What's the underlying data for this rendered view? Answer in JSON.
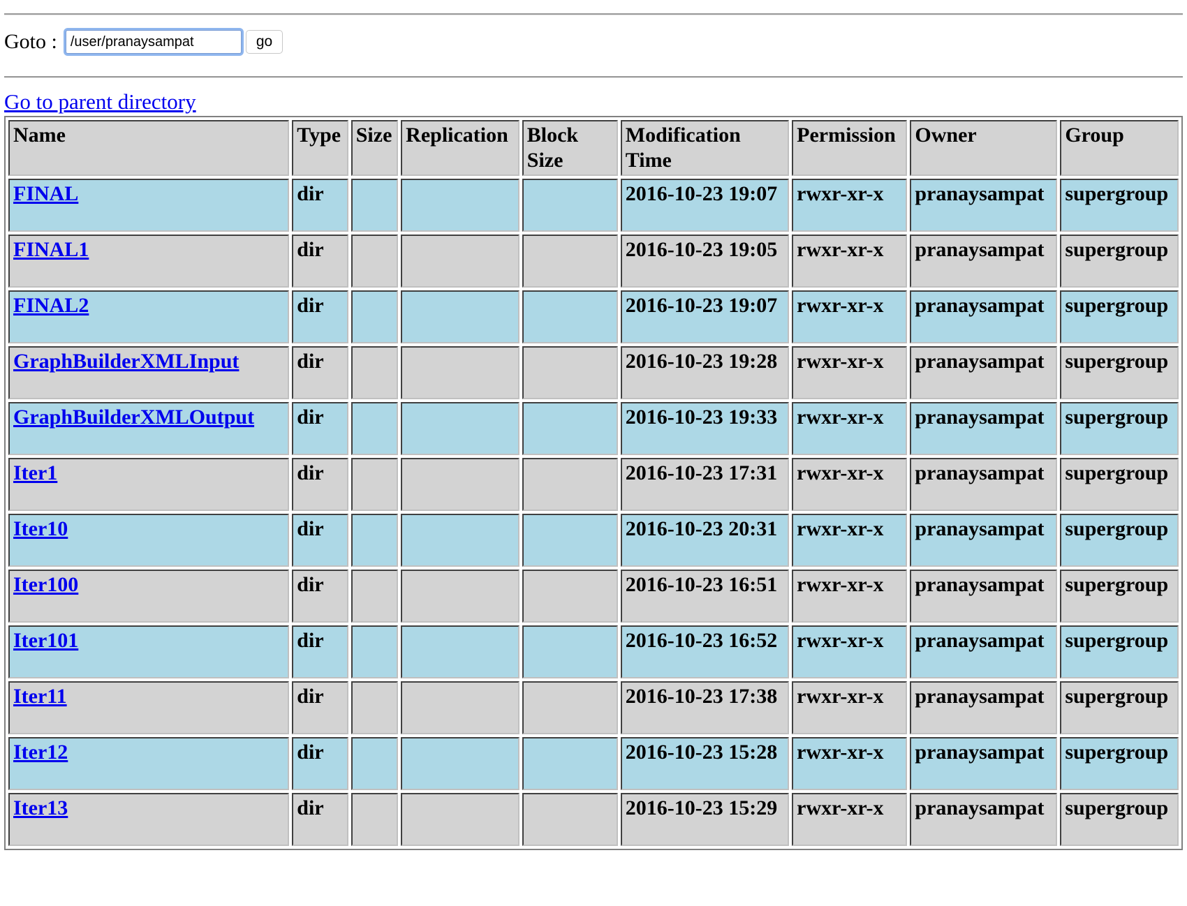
{
  "goto": {
    "label": "Goto :",
    "value": "/user/pranaysampat",
    "button": "go"
  },
  "parent_link": "Go to parent directory",
  "table": {
    "headers": [
      "Name",
      "Type",
      "Size",
      "Replication",
      "Block Size",
      "Modification Time",
      "Permission",
      "Owner",
      "Group"
    ],
    "rows": [
      {
        "name": "FINAL",
        "type": "dir",
        "size": "",
        "replication": "",
        "block_size": "",
        "mtime": "2016-10-23 19:07",
        "permission": "rwxr-xr-x",
        "owner": "pranaysampat",
        "group": "supergroup"
      },
      {
        "name": "FINAL1",
        "type": "dir",
        "size": "",
        "replication": "",
        "block_size": "",
        "mtime": "2016-10-23 19:05",
        "permission": "rwxr-xr-x",
        "owner": "pranaysampat",
        "group": "supergroup"
      },
      {
        "name": "FINAL2",
        "type": "dir",
        "size": "",
        "replication": "",
        "block_size": "",
        "mtime": "2016-10-23 19:07",
        "permission": "rwxr-xr-x",
        "owner": "pranaysampat",
        "group": "supergroup"
      },
      {
        "name": "GraphBuilderXMLInput",
        "type": "dir",
        "size": "",
        "replication": "",
        "block_size": "",
        "mtime": "2016-10-23 19:28",
        "permission": "rwxr-xr-x",
        "owner": "pranaysampat",
        "group": "supergroup"
      },
      {
        "name": "GraphBuilderXMLOutput",
        "type": "dir",
        "size": "",
        "replication": "",
        "block_size": "",
        "mtime": "2016-10-23 19:33",
        "permission": "rwxr-xr-x",
        "owner": "pranaysampat",
        "group": "supergroup"
      },
      {
        "name": "Iter1",
        "type": "dir",
        "size": "",
        "replication": "",
        "block_size": "",
        "mtime": "2016-10-23 17:31",
        "permission": "rwxr-xr-x",
        "owner": "pranaysampat",
        "group": "supergroup"
      },
      {
        "name": "Iter10",
        "type": "dir",
        "size": "",
        "replication": "",
        "block_size": "",
        "mtime": "2016-10-23 20:31",
        "permission": "rwxr-xr-x",
        "owner": "pranaysampat",
        "group": "supergroup"
      },
      {
        "name": "Iter100",
        "type": "dir",
        "size": "",
        "replication": "",
        "block_size": "",
        "mtime": "2016-10-23 16:51",
        "permission": "rwxr-xr-x",
        "owner": "pranaysampat",
        "group": "supergroup"
      },
      {
        "name": "Iter101",
        "type": "dir",
        "size": "",
        "replication": "",
        "block_size": "",
        "mtime": "2016-10-23 16:52",
        "permission": "rwxr-xr-x",
        "owner": "pranaysampat",
        "group": "supergroup"
      },
      {
        "name": "Iter11",
        "type": "dir",
        "size": "",
        "replication": "",
        "block_size": "",
        "mtime": "2016-10-23 17:38",
        "permission": "rwxr-xr-x",
        "owner": "pranaysampat",
        "group": "supergroup"
      },
      {
        "name": "Iter12",
        "type": "dir",
        "size": "",
        "replication": "",
        "block_size": "",
        "mtime": "2016-10-23 15:28",
        "permission": "rwxr-xr-x",
        "owner": "pranaysampat",
        "group": "supergroup"
      },
      {
        "name": "Iter13",
        "type": "dir",
        "size": "",
        "replication": "",
        "block_size": "",
        "mtime": "2016-10-23 15:29",
        "permission": "rwxr-xr-x",
        "owner": "pranaysampat",
        "group": "supergroup"
      }
    ]
  }
}
